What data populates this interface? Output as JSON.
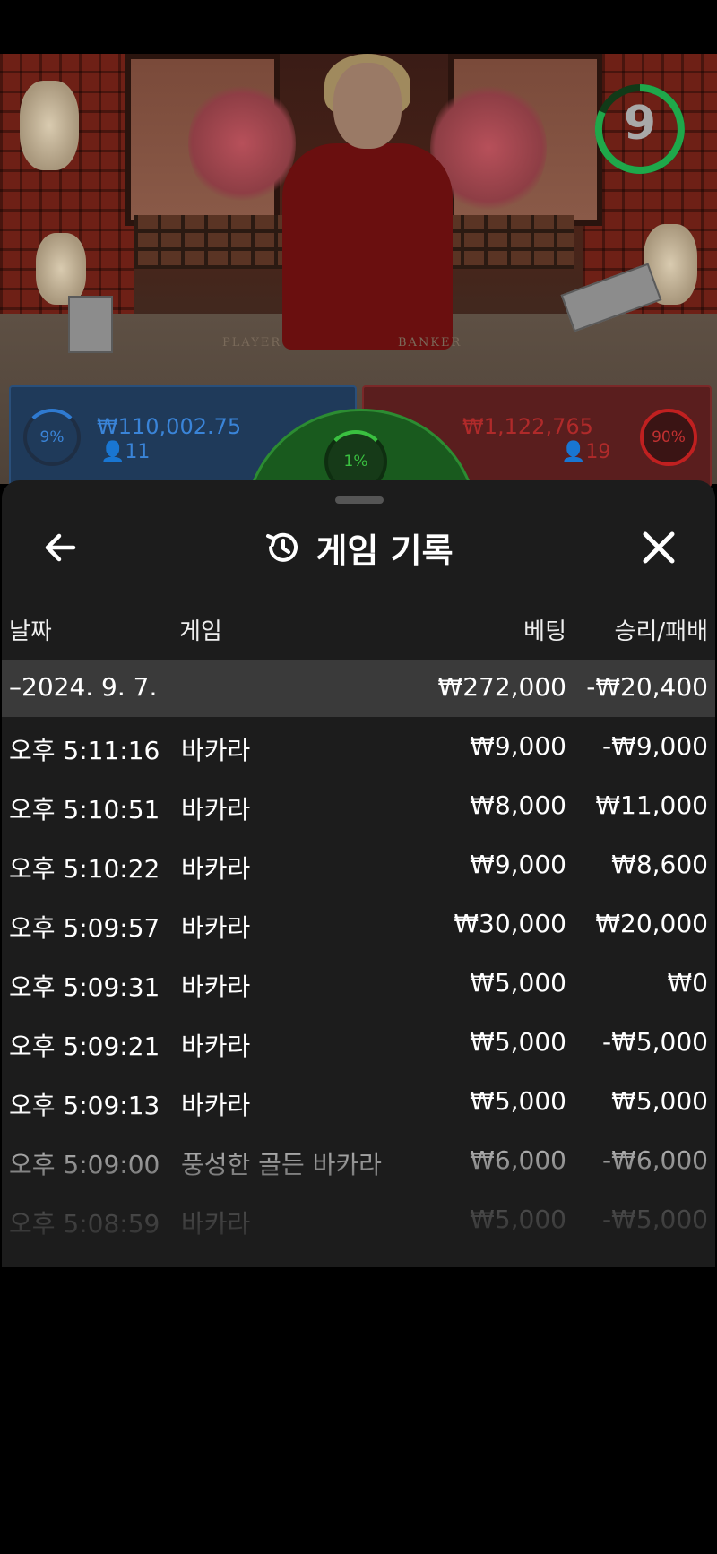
{
  "video": {
    "timer": "9",
    "table_labels": {
      "player": "PLAYER",
      "banker": "BANKER"
    },
    "player": {
      "percent": "9%",
      "amount": "₩110,002.75",
      "count": "11"
    },
    "banker": {
      "percent": "90%",
      "amount": "₩1,122,765",
      "count": "19"
    },
    "tie": {
      "percent": "1%"
    }
  },
  "sheet": {
    "title": "게임 기록",
    "back_icon": "arrow-left-icon",
    "history_icon": "history-icon",
    "close_icon": "close-icon",
    "columns": {
      "date": "날짜",
      "game": "게임",
      "bet": "베팅",
      "result": "승리/패배"
    },
    "group": {
      "date": "–2024. 9. 7.",
      "bet": "₩272,000",
      "result": "-₩20,400"
    },
    "rows": [
      {
        "time": "오후 5:11:16",
        "game": "바카라",
        "bet": "₩9,000",
        "result": "-₩9,000"
      },
      {
        "time": "오후 5:10:51",
        "game": "바카라",
        "bet": "₩8,000",
        "result": "₩11,000"
      },
      {
        "time": "오후 5:10:22",
        "game": "바카라",
        "bet": "₩9,000",
        "result": "₩8,600"
      },
      {
        "time": "오후 5:09:57",
        "game": "바카라",
        "bet": "₩30,000",
        "result": "₩20,000"
      },
      {
        "time": "오후 5:09:31",
        "game": "바카라",
        "bet": "₩5,000",
        "result": "₩0"
      },
      {
        "time": "오후 5:09:21",
        "game": "바카라",
        "bet": "₩5,000",
        "result": "-₩5,000"
      },
      {
        "time": "오후 5:09:13",
        "game": "바카라",
        "bet": "₩5,000",
        "result": "₩5,000"
      },
      {
        "time": "오후 5:09:00",
        "game": "풍성한 골든 바카라",
        "bet": "₩6,000",
        "result": "-₩6,000"
      },
      {
        "time": "오후 5:08:59",
        "game": "바카라",
        "bet": "₩5,000",
        "result": "-₩5,000"
      }
    ]
  }
}
